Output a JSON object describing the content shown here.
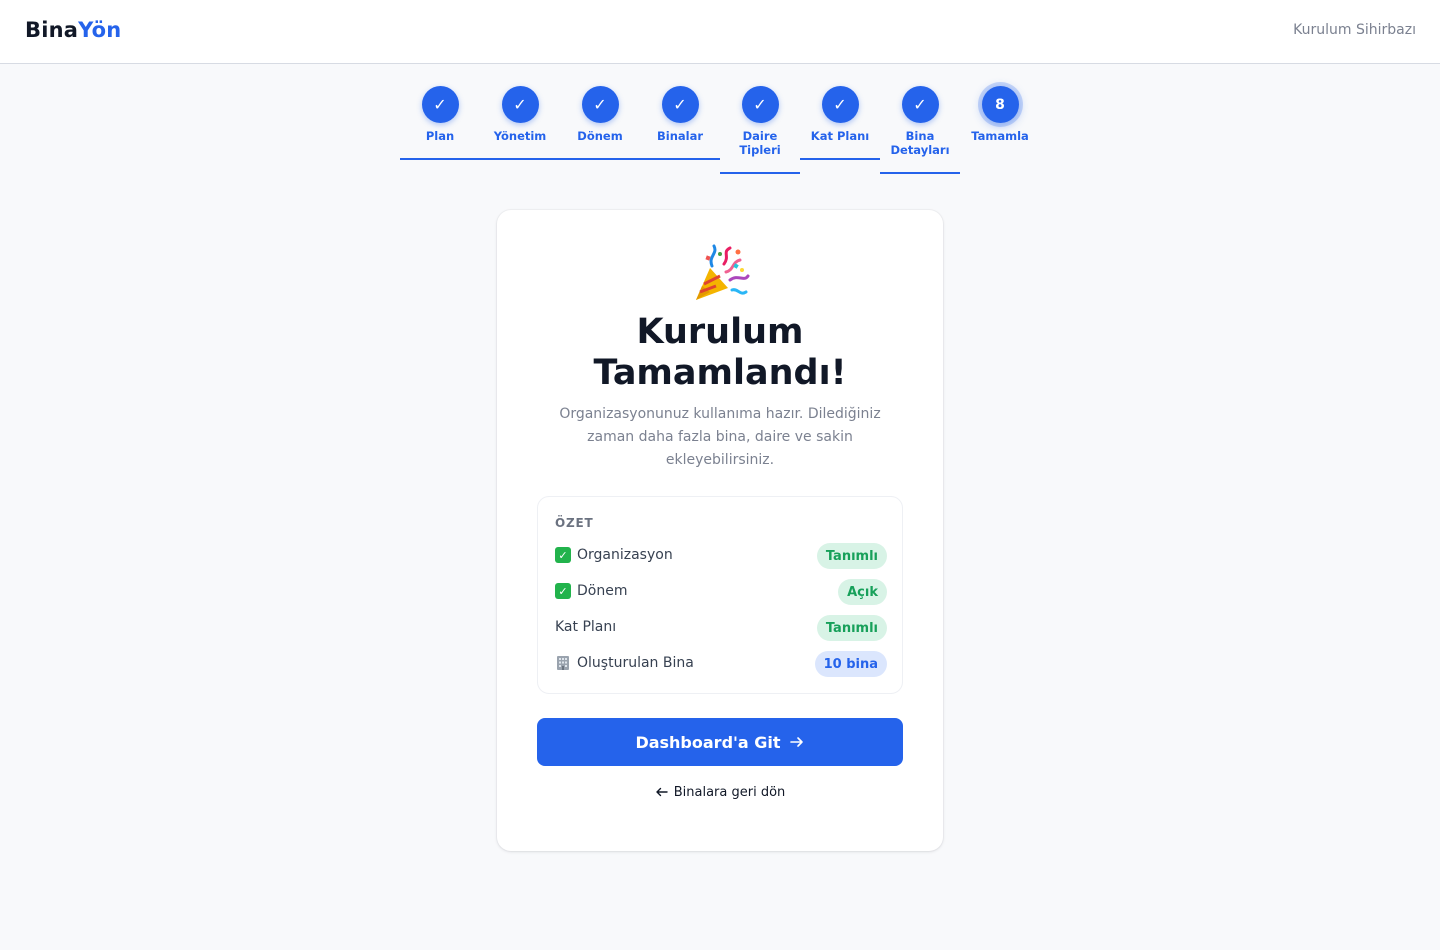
{
  "header": {
    "logo_part1": "Bina",
    "logo_part2": "Yön",
    "wizard_label": "Kurulum Sihirbazı"
  },
  "steps": [
    {
      "label": "Plan",
      "status": "done"
    },
    {
      "label": "Yönetim",
      "status": "done"
    },
    {
      "label": "Dönem",
      "status": "done"
    },
    {
      "label": "Binalar",
      "status": "done"
    },
    {
      "label": "Daire Tipleri",
      "status": "done"
    },
    {
      "label": "Kat Planı",
      "status": "done"
    },
    {
      "label": "Bina Detayları",
      "status": "done"
    },
    {
      "label": "Tamamla",
      "status": "current",
      "number": "8"
    }
  ],
  "completion": {
    "icon": "party-popper-icon",
    "title": "Kurulum Tamamlandı!",
    "description": "Organizasyonunuz kullanıma hazır. Dilediğiniz zaman daha fazla bina, daire ve sakin ekleyebilirsiniz."
  },
  "summary": {
    "title": "ÖZET",
    "rows": [
      {
        "icon": "check-mark-icon",
        "label": "Organizasyon",
        "badge": "Tanımlı",
        "badge_style": "green"
      },
      {
        "icon": "check-mark-icon",
        "label": "Dönem",
        "badge": "Açık",
        "badge_style": "green"
      },
      {
        "icon": "",
        "label": "Kat Planı",
        "badge": "Tanımlı",
        "badge_style": "green"
      },
      {
        "icon": "building-icon",
        "label": "Oluşturulan Bina",
        "badge": "10 bina",
        "badge_style": "blue"
      }
    ]
  },
  "actions": {
    "primary_label": "Dashboard'a Git",
    "back_label": "Binalara geri dön"
  },
  "colors": {
    "accent": "#2563eb",
    "success": "#17a05a",
    "background": "#f8f9fb"
  }
}
